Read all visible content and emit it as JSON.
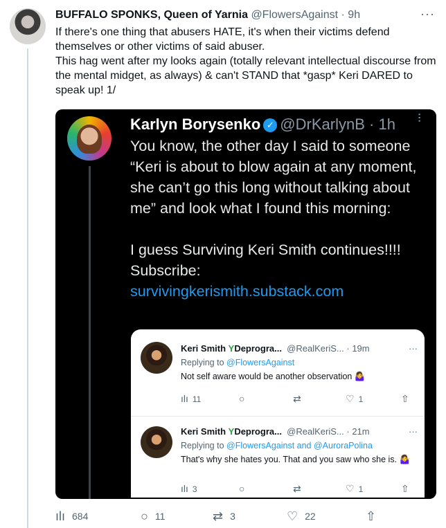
{
  "tweet": {
    "author_name": "BUFFALO SPONKS, Queen of Yarnia",
    "author_handle": "@FlowersAgainst",
    "separator": "·",
    "time": "9h",
    "text_lines": [
      "If there's one thing that abusers HATE, it's when their victims defend themselves or other victims of said abuser.",
      "This hag went after my looks again (totally relevant intellectual discourse from the mental midget, as always) & can't STAND that *gasp* Keri DARED to speak up! 1/"
    ],
    "actions": {
      "views": "684",
      "replies": "11",
      "retweets": "3",
      "likes": "22"
    }
  },
  "embedded": {
    "name": "Karlyn Borysenko",
    "verified_glyph": "✓",
    "handle": "@DrKarlynB",
    "separator": "·",
    "time": "1h",
    "text_line1": "You know, the other day I said to someone “Keri is about to blow again at any moment, she can’t go this long without talking about me” and look what I found this morning:",
    "text_line2": "I guess Surviving Keri Smith continues!!!!",
    "text_line3": "Subscribe:",
    "link": "survivingkerismith.substack.com"
  },
  "replies": [
    {
      "name": "Keri Smith",
      "badge": "Y",
      "deprogram": "Deprogra...",
      "handle": "@RealKeriS...",
      "separator": "·",
      "time": "19m",
      "replying_to": "Replying to",
      "mentions": "@FlowersAgainst",
      "text": "Not self aware would be another observation 🤷‍♀️",
      "views": "11",
      "likes": "1"
    },
    {
      "name": "Keri Smith",
      "badge": "Y",
      "deprogram": "Deprogra...",
      "handle": "@RealKeriS...",
      "separator": "·",
      "time": "21m",
      "replying_to": "Replying to",
      "mentions": "@FlowersAgainst and @AuroraPolina",
      "text": "That's why she hates you. That and you saw who she is. 🤷‍♀️",
      "views": "3",
      "likes": "1"
    }
  ],
  "icons": {
    "more": "more-icon",
    "views": "views-icon",
    "reply": "reply-icon",
    "retweet": "retweet-icon",
    "like": "like-icon",
    "share": "share-icon"
  },
  "colors": {
    "accent": "#1d9bf0",
    "text": "#0f1419",
    "muted": "#536471",
    "screenshot_bg": "#000000"
  }
}
